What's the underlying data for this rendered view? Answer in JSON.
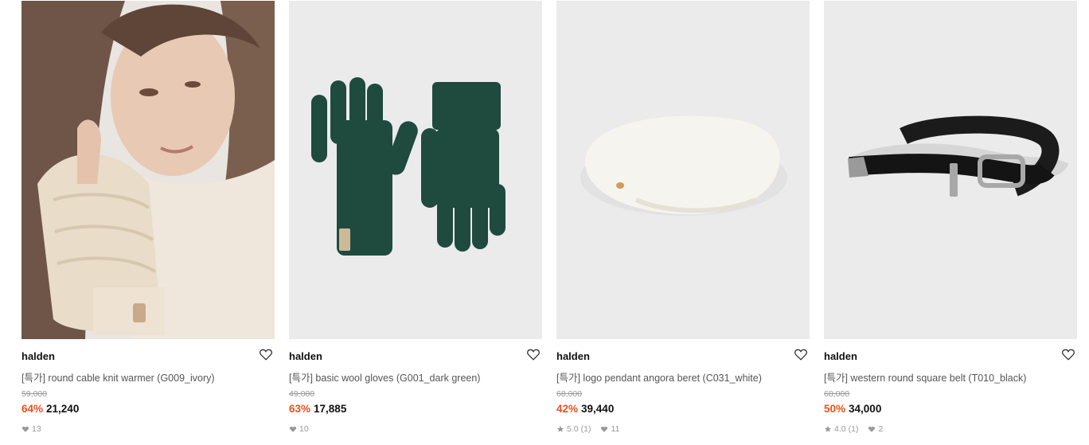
{
  "products": [
    {
      "brand": "halden",
      "name": "[특가] round cable knit warmer (G009_ivory)",
      "original_price": "59,000",
      "discount": "64%",
      "price": "21,240",
      "likes": "13",
      "rating": null,
      "review_count": null,
      "image": "knit-warmer-model-photo"
    },
    {
      "brand": "halden",
      "name": "[특가] basic wool gloves (G001_dark green)",
      "original_price": "49,000",
      "discount": "63%",
      "price": "17,885",
      "likes": "10",
      "rating": null,
      "review_count": null,
      "image": "dark-green-gloves"
    },
    {
      "brand": "halden",
      "name": "[특가] logo pendant angora beret (C031_white)",
      "original_price": "68,000",
      "discount": "42%",
      "price": "39,440",
      "likes": "11",
      "rating": "5.0",
      "review_count": "(1)",
      "image": "white-beret"
    },
    {
      "brand": "halden",
      "name": "[특가] western round square belt (T010_black)",
      "original_price": "68,000",
      "discount": "50%",
      "price": "34,000",
      "likes": "2",
      "rating": "4.0",
      "review_count": "(1)",
      "image": "black-belt"
    }
  ],
  "colors": {
    "discount": "#e8521e",
    "thumb_bg": "#ebebeb",
    "muted": "#999999"
  }
}
